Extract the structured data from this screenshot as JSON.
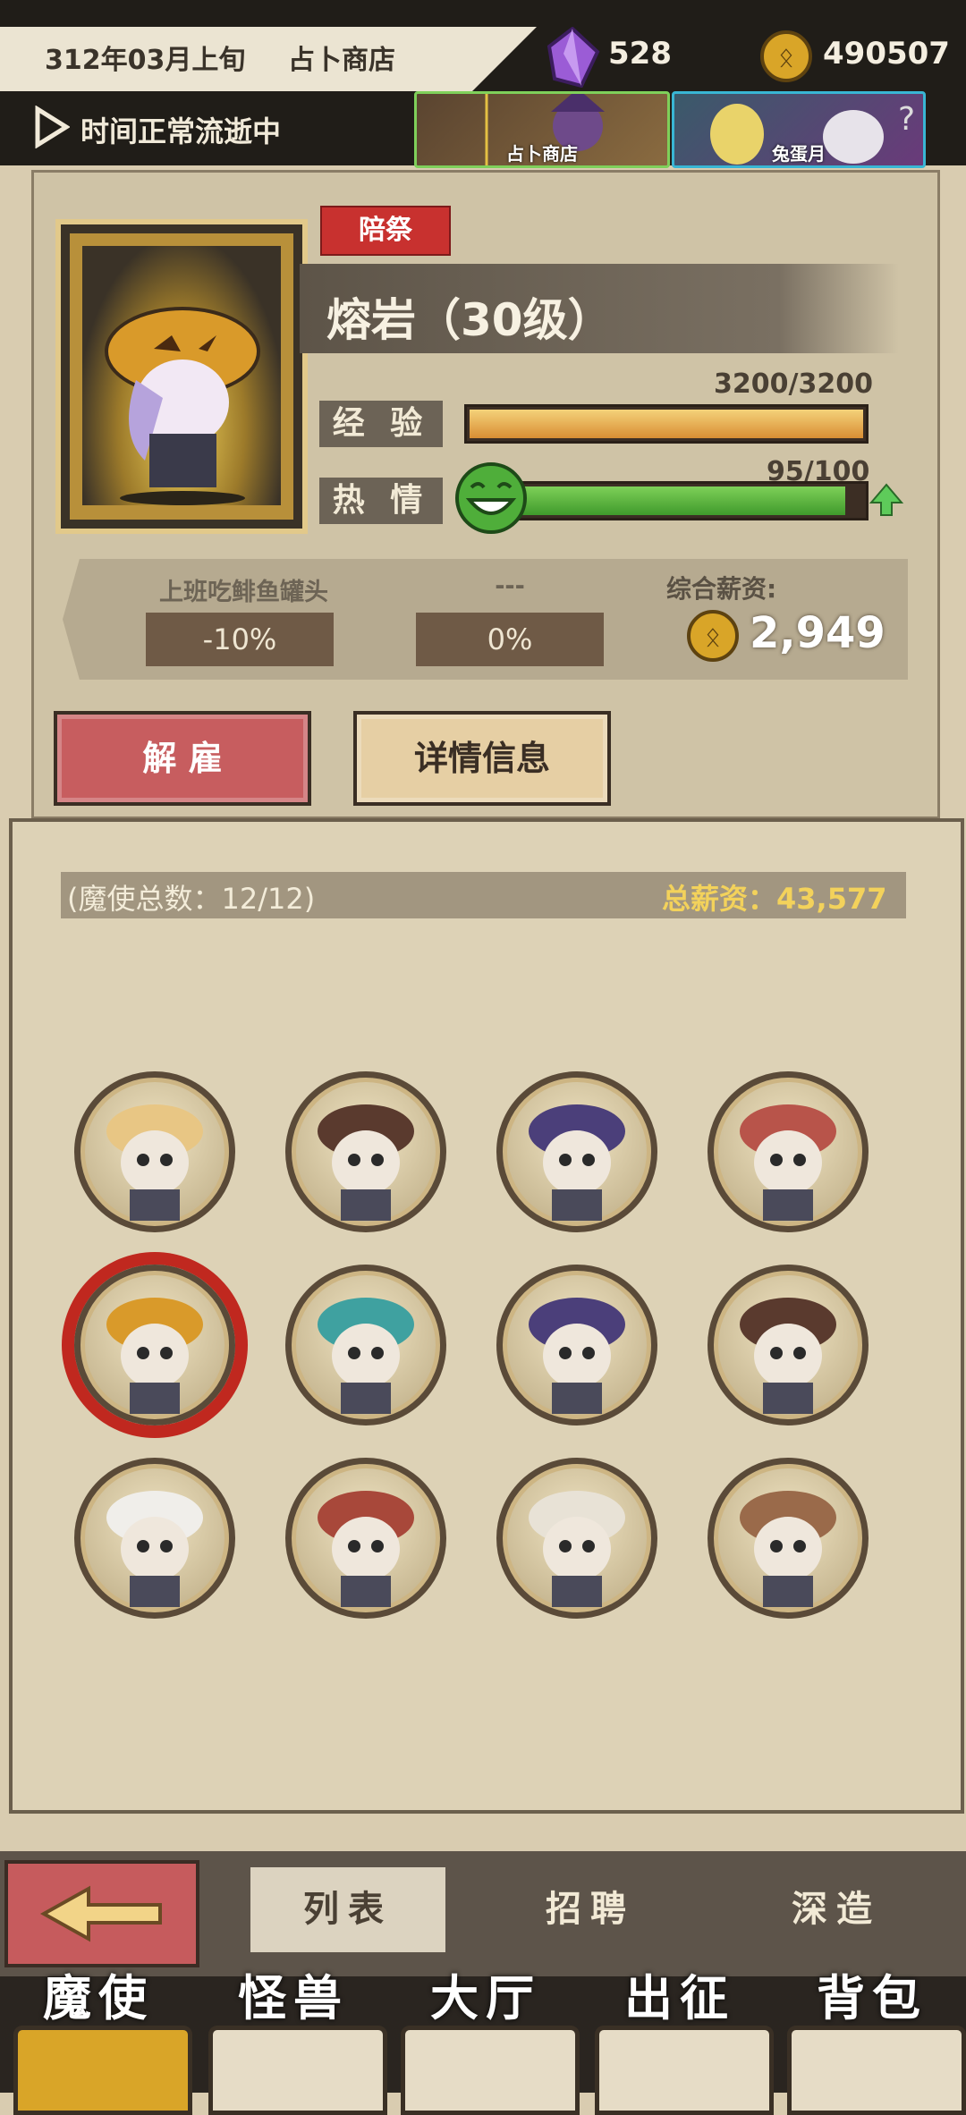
{
  "topbar": {
    "date": "312年03月上旬",
    "location": "占卜商店",
    "crystals": "528",
    "coins": "490507",
    "time_status": "时间正常流逝中",
    "events": [
      {
        "label": "占卜商店"
      },
      {
        "label": "兔蛋月"
      }
    ]
  },
  "character": {
    "role": "陪祭",
    "name": "熔岩（30级）",
    "exp_label": "经 验",
    "exp_value": "3200/3200",
    "exp_fraction": 1.0,
    "passion_label": "热 情",
    "passion_value": "95/100",
    "passion_fraction": 0.95,
    "bonuses": [
      {
        "title": "上班吃鲱鱼罐头",
        "value": "-10%"
      },
      {
        "title": "---",
        "value": "0%"
      }
    ],
    "salary_label": "综合薪资:",
    "salary_value": "2,949",
    "fire_button": "解 雇",
    "detail_button": "详情信息"
  },
  "roster": {
    "count_text": "(魔使总数：12/12)",
    "total_text": "总薪资：43,577",
    "selected_index": 4,
    "avatars": [
      "hat-witch",
      "dark-girl",
      "purple-hat",
      "red-eyes",
      "pumpkin-lava",
      "horned-teal",
      "purple-hat-2",
      "dark-girl-2",
      "sheep",
      "masked",
      "white-hair",
      "red-eye-lion"
    ]
  },
  "tabs": {
    "list": "列表",
    "recruit": "招聘",
    "forge": "深造"
  },
  "nav": [
    {
      "label": "魔使"
    },
    {
      "label": "怪兽"
    },
    {
      "label": "大厅"
    },
    {
      "label": "出征"
    },
    {
      "label": "背包"
    }
  ],
  "colors": {
    "accent_red": "#c8312f",
    "gold": "#f3d25b",
    "passion_green": "#4fae3a",
    "exp_orange": "#e2a44a"
  }
}
